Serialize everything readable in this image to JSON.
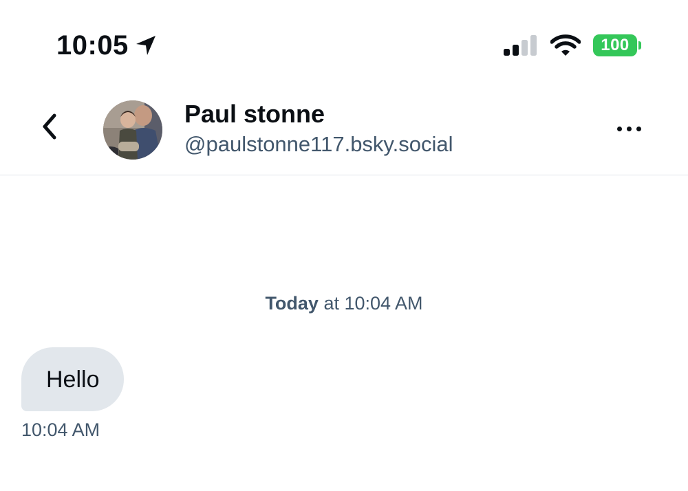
{
  "status_bar": {
    "time": "10:05",
    "battery_level": "100",
    "battery_color": "#34c759",
    "icons": [
      "location-arrow-icon",
      "cellular-signal-icon",
      "wifi-icon",
      "battery-icon"
    ]
  },
  "header": {
    "back_icon": "chevron-left-icon",
    "name": "Paul stonne",
    "handle": "@paulstonne117.bsky.social",
    "more_icon": "ellipsis-icon"
  },
  "conversation": {
    "date_day": "Today",
    "date_rest": " at 10:04 AM",
    "messages": [
      {
        "text": "Hello",
        "time": "10:04 AM",
        "direction": "incoming"
      }
    ]
  },
  "colors": {
    "text_primary": "#0b0f14",
    "text_secondary": "#42576c",
    "bubble_incoming": "#e2e7ec",
    "divider": "#dfe3e8"
  }
}
